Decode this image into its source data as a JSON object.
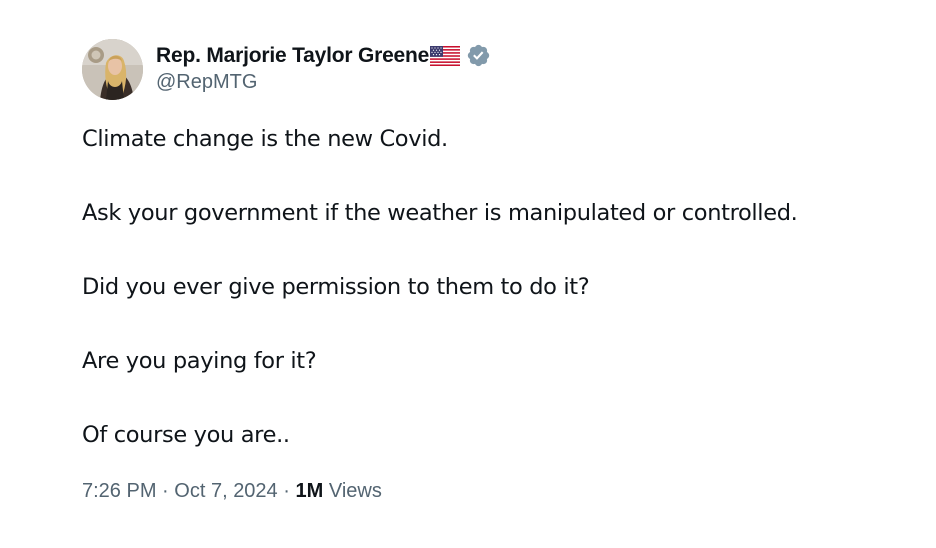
{
  "author": {
    "display_name": "Rep. Marjorie Taylor Greene",
    "handle": "@RepMTG",
    "badges": [
      "us-flag-icon",
      "verified-icon"
    ],
    "verified_color": "#829aab"
  },
  "tweet": {
    "paragraphs": [
      "Climate change is the new Covid.",
      "Ask your government if the weather is manipulated or controlled.",
      "Did you ever give permission to them to do it?",
      "Are you paying for it?",
      "Of course you are.."
    ]
  },
  "meta": {
    "time": "7:26 PM",
    "separator": "·",
    "date": "Oct 7, 2024",
    "views_count": "1M",
    "views_label": "Views"
  },
  "colors": {
    "text_primary": "#0f1419",
    "text_secondary": "#536471"
  }
}
